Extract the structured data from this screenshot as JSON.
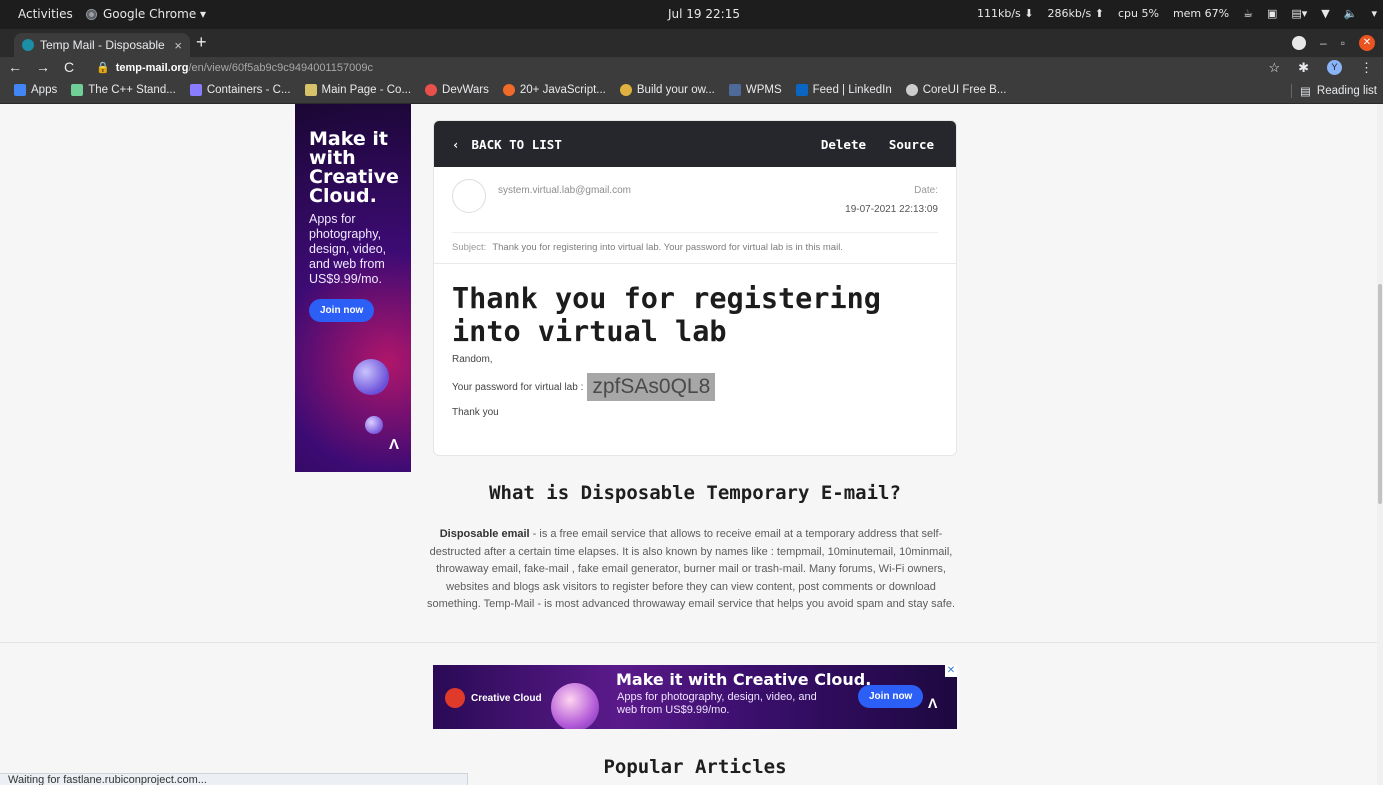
{
  "system_bar": {
    "activities": "Activities",
    "app": "Google Chrome ▾",
    "clock": "Jul 19 22:15",
    "net_down": "111kb/s ⬇",
    "net_up": "286kb/s ⬆",
    "cpu": "cpu 5%",
    "mem": "mem 67%"
  },
  "tab": {
    "title": "Temp Mail - Disposable Te",
    "close": "×",
    "new": "+"
  },
  "address": {
    "host": "temp-mail.org",
    "path": "/en/view/60f5ab9c9c9494001157009c"
  },
  "bookmarks": {
    "items": [
      {
        "label": "Apps",
        "color": "#4285f4"
      },
      {
        "label": "The C++ Stand...",
        "color": "#6fcf97"
      },
      {
        "label": "Containers - C...",
        "color": "#8a7cff"
      },
      {
        "label": "Main Page - Co...",
        "color": "#d7c16b"
      },
      {
        "label": "DevWars",
        "color": "#e8504a"
      },
      {
        "label": "20+ JavaScript...",
        "color": "#f06a2a"
      },
      {
        "label": "Build your ow...",
        "color": "#e0b040"
      },
      {
        "label": "WPMS",
        "color": "#4d6a9a"
      },
      {
        "label": "Feed | LinkedIn",
        "color": "#0a66c2"
      },
      {
        "label": "CoreUI Free B...",
        "color": "#cccccc"
      }
    ],
    "reading_list": "Reading list"
  },
  "vertical_ad": {
    "headline": "Make it with Creative Cloud.",
    "sub": "Apps for photography, design, video, and web from US$9.99/mo.",
    "cta": "Join now"
  },
  "mail": {
    "back_label": "BACK TO LIST",
    "delete_label": "Delete",
    "source_label": "Source",
    "from": "system.virtual.lab@gmail.com",
    "date_label": "Date:",
    "date": "19-07-2021 22:13:09",
    "subject_label": "Subject:",
    "subject": "Thank you for registering into virtual lab. Your password for virtual lab is in this mail.",
    "heading": "Thank you for registering into virtual lab",
    "greeting": "Random,",
    "password_label": "Your password for virtual lab :",
    "password": "zpfSAs0QL8",
    "closing": "Thank you"
  },
  "info": {
    "title": "What is Disposable Temporary E-mail?",
    "bold": "Disposable email",
    "text": " - is a free email service that allows to receive email at a temporary address that self-destructed after a certain time elapses. It is also known by names like : tempmail, 10minutemail, 10minmail, throwaway email, fake-mail , fake email generator, burner mail or trash-mail. Many forums, Wi-Fi owners, websites and blogs ask visitors to register before they can view content, post comments or download something. Temp-Mail - is most advanced throwaway email service that helps you avoid spam and stay safe."
  },
  "horizontal_ad": {
    "brand": "Creative Cloud",
    "headline": "Make it with Creative Cloud.",
    "sub": "Apps for photography, design, video, and web from US$9.99/mo.",
    "cta": "Join now"
  },
  "popular_title": "Popular Articles",
  "status": "Waiting for fastlane.rubiconproject.com..."
}
